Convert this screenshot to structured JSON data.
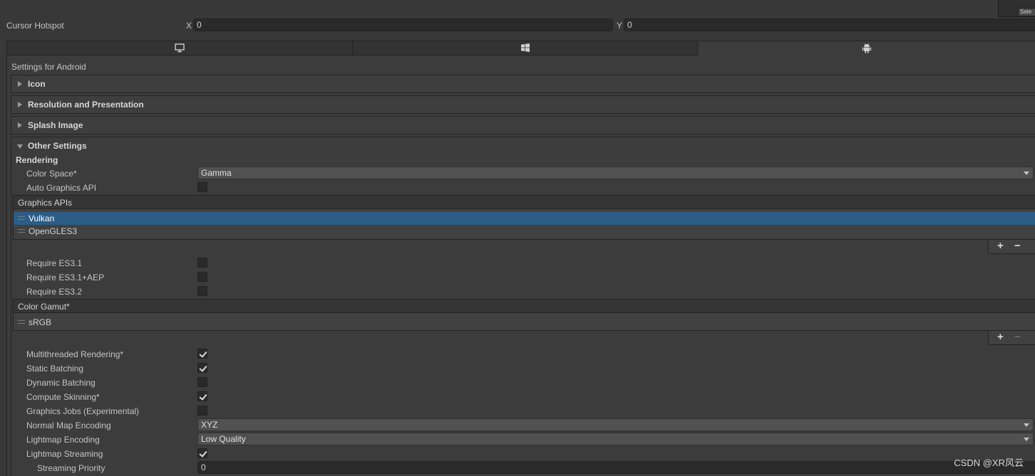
{
  "top_corner": {
    "label": "Sele"
  },
  "cursor_hotspot": {
    "label": "Cursor Hotspot",
    "x_label": "X",
    "x_value": "0",
    "y_label": "Y",
    "y_value": "0"
  },
  "platform_tabs": [
    {
      "name": "Standalone",
      "icon": "monitor-icon",
      "active": false
    },
    {
      "name": "Windows",
      "icon": "windows-icon",
      "active": false
    },
    {
      "name": "Android",
      "icon": "android-icon",
      "active": true
    }
  ],
  "settings_title": "Settings for Android",
  "foldouts": {
    "icon": "Icon",
    "resolution": "Resolution and Presentation",
    "splash": "Splash Image",
    "other": "Other Settings"
  },
  "rendering": {
    "header": "Rendering",
    "color_space_label": "Color Space*",
    "color_space_value": "Gamma",
    "auto_graphics_label": "Auto Graphics API",
    "auto_graphics_checked": false
  },
  "graphics_apis": {
    "header": "Graphics APIs",
    "items": [
      "Vulkan",
      "OpenGLES3"
    ],
    "selected": "Vulkan"
  },
  "requires": [
    {
      "label": "Require ES3.1",
      "checked": false
    },
    {
      "label": "Require ES3.1+AEP",
      "checked": false
    },
    {
      "label": "Require ES3.2",
      "checked": false
    }
  ],
  "color_gamut": {
    "header": "Color Gamut*",
    "items": [
      "sRGB"
    ]
  },
  "options": [
    {
      "label": "Multithreaded Rendering*",
      "checked": true
    },
    {
      "label": "Static Batching",
      "checked": true
    },
    {
      "label": "Dynamic Batching",
      "checked": false
    },
    {
      "label": "Compute Skinning*",
      "checked": true
    },
    {
      "label": "Graphics Jobs (Experimental)",
      "checked": false
    }
  ],
  "normal_map": {
    "label": "Normal Map Encoding",
    "value": "XYZ"
  },
  "lightmap_encoding": {
    "label": "Lightmap Encoding",
    "value": "Low Quality"
  },
  "lightmap_streaming": {
    "label": "Lightmap Streaming",
    "checked": true
  },
  "streaming_priority": {
    "label": "Streaming Priority",
    "value": "0"
  },
  "list_buttons": {
    "plus": "+",
    "minus": "−"
  },
  "watermark": "CSDN @XR风云",
  "colors": {
    "background": "#383838",
    "selection": "#2c5d87",
    "field": "#2a2a2a",
    "dropdown": "#515151"
  }
}
